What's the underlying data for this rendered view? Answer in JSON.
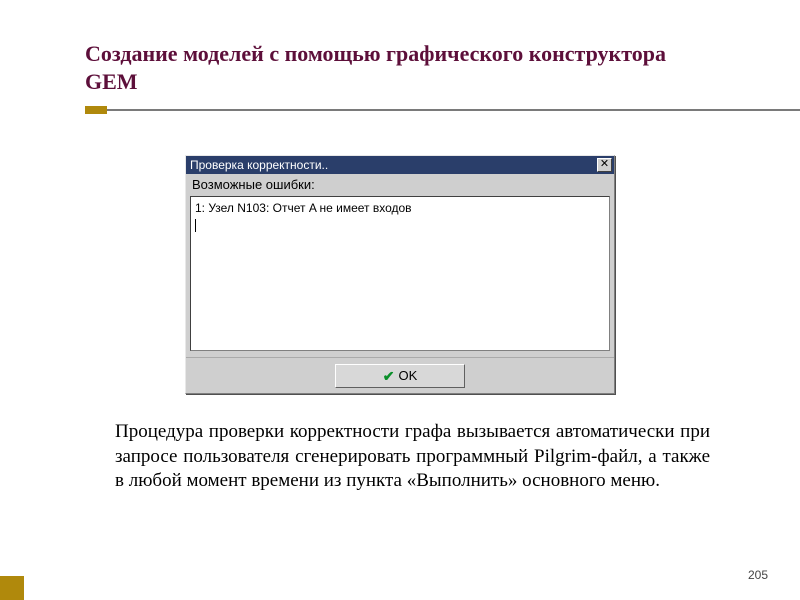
{
  "slide": {
    "title": "Создание моделей с помощью графического конструктора GEM",
    "page_number": "205",
    "body": "Процедура проверки корректности графа вызывается автоматически при запросе пользователя сгенерировать программный Pilgrim-файл, а также в любой момент времени из пункта «Выполнить» основного меню."
  },
  "dialog": {
    "title": "Проверка корректности..",
    "group_label": "Возможные ошибки:",
    "errors": [
      "1: Узел N103: Отчет A не имеет входов"
    ],
    "ok_label": "OK",
    "close_glyph": "✕",
    "check_glyph": "✔"
  }
}
